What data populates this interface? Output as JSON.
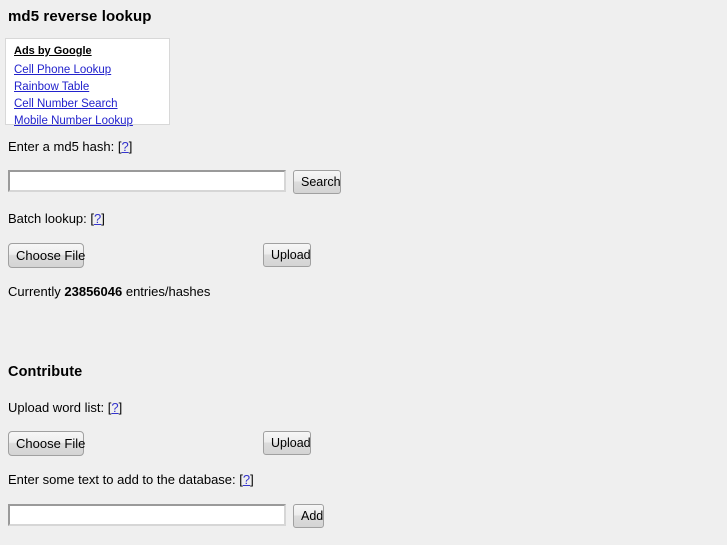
{
  "page": {
    "title": "md5 reverse lookup",
    "background_color": "#efefef",
    "link_color": "#2222cc"
  },
  "ads": {
    "title": "Ads by Google",
    "links": [
      {
        "label": "Cell Phone Lookup"
      },
      {
        "label": "Rainbow Table"
      },
      {
        "label": "Cell Number Search"
      },
      {
        "label": "Mobile Number Lookup"
      }
    ]
  },
  "lookup": {
    "label": "Enter a md5 hash:",
    "help": "[?]",
    "help_bracket_open": "[",
    "help_mark": "?",
    "help_bracket_close": "]",
    "input_value": "",
    "input_placeholder": "",
    "search_button": "Search"
  },
  "batch": {
    "label": "Batch lookup:",
    "choose_file_button": "Choose File",
    "upload_button": "Upload"
  },
  "stats": {
    "prefix": "Currently",
    "count": "23856046",
    "suffix": "entries/hashes"
  },
  "contribute": {
    "heading": "Contribute",
    "wordlist_label": "Upload word list:",
    "choose_file_button": "Choose File",
    "upload_button": "Upload",
    "text_label": "Enter some text to add to the database:",
    "text_input_value": "",
    "text_input_placeholder": "",
    "add_button": "Add"
  }
}
